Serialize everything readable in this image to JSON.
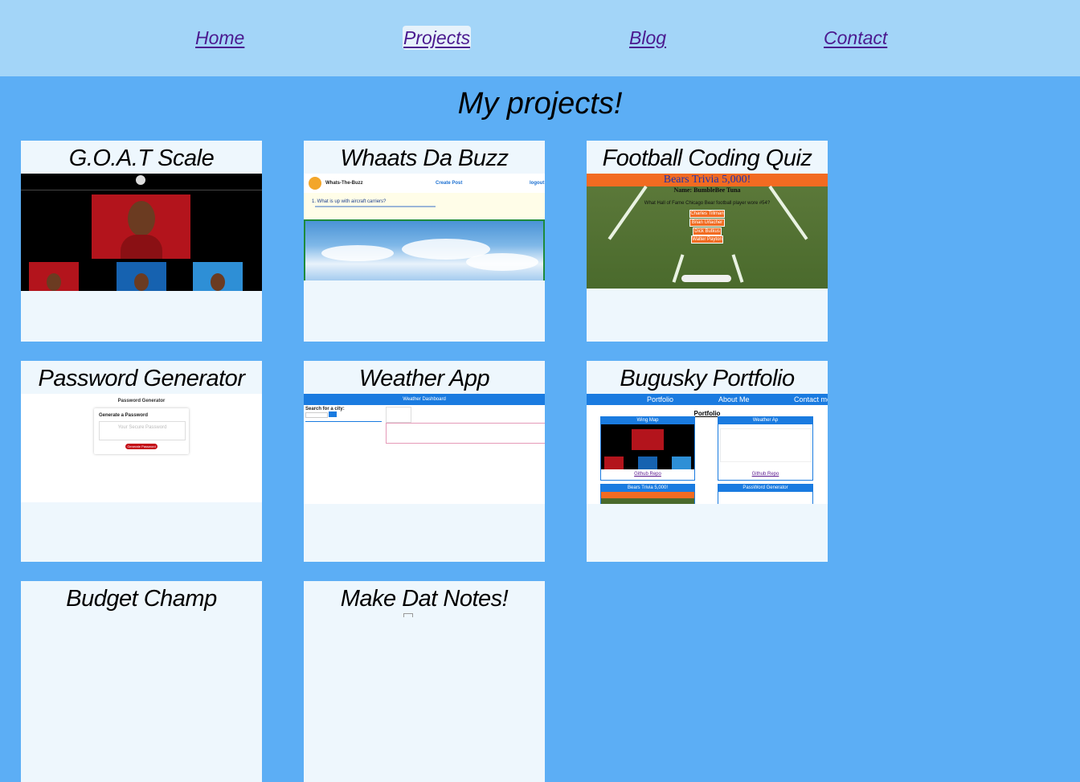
{
  "nav": {
    "items": [
      {
        "label": "Home"
      },
      {
        "label": "Projects"
      },
      {
        "label": "Blog"
      },
      {
        "label": "Contact"
      }
    ],
    "active": "Projects"
  },
  "page": {
    "heading": "My projects!"
  },
  "projects": [
    {
      "title": "G.O.A.T Scale"
    },
    {
      "title": "Whaats Da Buzz"
    },
    {
      "title": "Football Coding Quiz"
    },
    {
      "title": "Password Generator"
    },
    {
      "title": "Weather App"
    },
    {
      "title": "Bugusky Portfolio"
    },
    {
      "title": "Budget Champ"
    },
    {
      "title": "Make Dat Notes!"
    }
  ],
  "screenshots": {
    "buzz": {
      "brand": "Whats-The-Buzz",
      "create": "Create Post",
      "logout": "logout",
      "post": "1. What is up with aircraft carriers?"
    },
    "football": {
      "title": "Bears Trivia 5,000!",
      "name": "Name: BumbleBee Tuna",
      "question": "What Hall of Fame Chicago Bear football player wore #54?",
      "options": [
        "Charles Tillman",
        "Brian Urlacher",
        "Dick Butkus",
        "Walter Payton"
      ]
    },
    "password": {
      "title": "Password Generator",
      "label": "Generate a Password",
      "placeholder": "Your Secure Password",
      "button": "Generate Password"
    },
    "weather": {
      "title": "Weather Dashboard",
      "search_label": "Search for a city:"
    },
    "portfolio": {
      "nav": [
        "Portfolio",
        "About Me",
        "Contact me"
      ],
      "heading": "Portfolio",
      "cards": [
        "Wing Map",
        "Weather Ap",
        "Bears Trivia 5,000!",
        "PassWord Generator"
      ],
      "repo": "Github Repo"
    }
  },
  "colors": {
    "background": "#5caef5",
    "navbar": "#a3d5f8",
    "card": "#eef7fd",
    "link": "#4b1a8f"
  }
}
